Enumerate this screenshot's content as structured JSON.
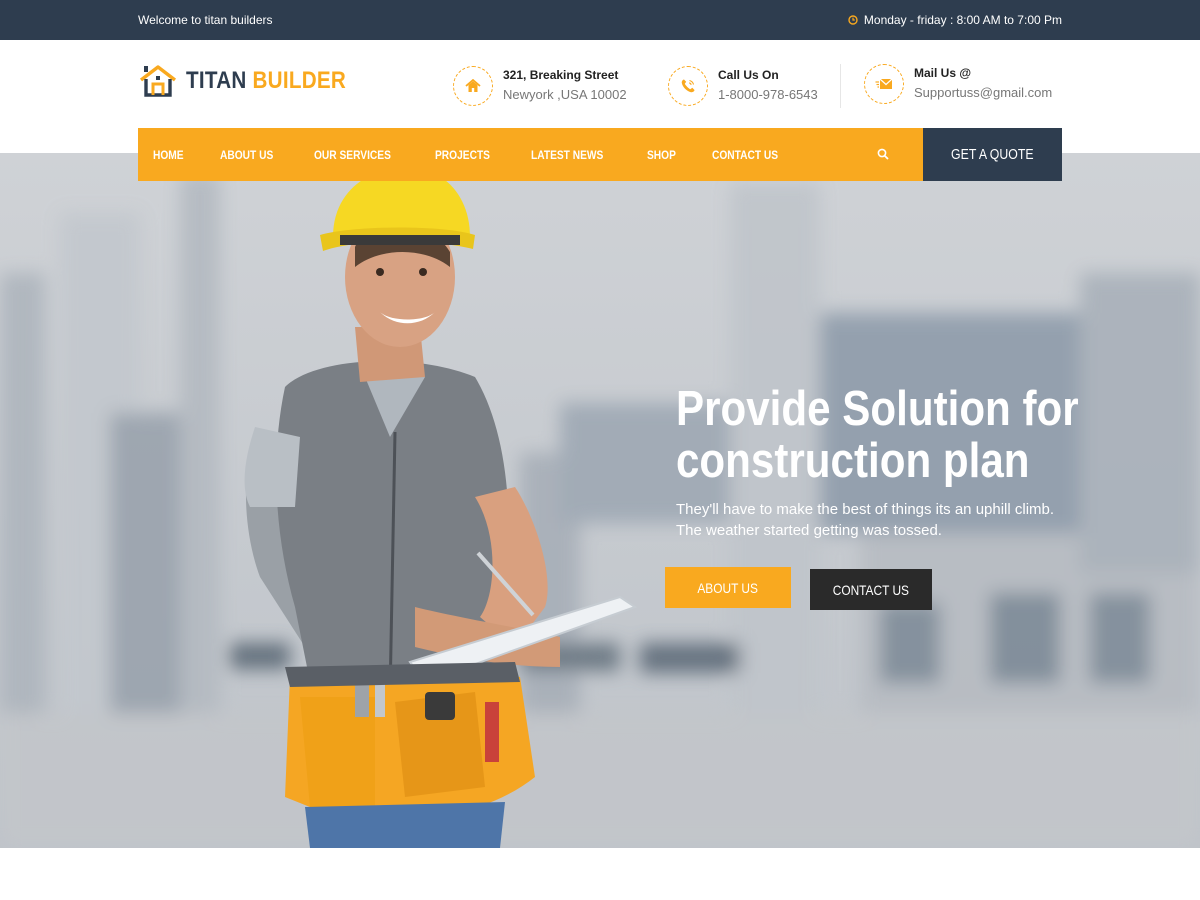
{
  "topbar": {
    "welcome": "Welcome to titan builders",
    "hours": "Monday - friday : 8:00 AM to 7:00 Pm",
    "hours_icon": "clock-icon"
  },
  "logo": {
    "word1": "TITAN",
    "word2": "BUILDER",
    "icon": "house-icon"
  },
  "contact_info": {
    "address": {
      "title": "321, Breaking Street",
      "detail": "Newyork ,USA 10002",
      "icon": "home-icon"
    },
    "phone": {
      "title": "Call Us On",
      "detail": "1-8000-978-6543",
      "icon": "phone-icon"
    },
    "mail": {
      "title": "Mail Us @",
      "detail": "Supportuss@gmail.com",
      "icon": "envelope-icon"
    }
  },
  "nav": {
    "items": [
      {
        "label": "HOME"
      },
      {
        "label": "ABOUT US"
      },
      {
        "label": "OUR SERVICES"
      },
      {
        "label": "PROJECTS"
      },
      {
        "label": "LATEST NEWS"
      },
      {
        "label": "SHOP"
      },
      {
        "label": "CONTACT US"
      }
    ],
    "search_icon": "search-icon",
    "quote_label": "GET A QUOTE"
  },
  "hero": {
    "title_line1": "Provide Solution for",
    "title_line2": "construction plan",
    "subtitle_line1": "They'll have to make the best of things its an uphill climb.",
    "subtitle_line2": "The weather started getting was tossed.",
    "about_button": "ABOUT US",
    "contact_button": "CONTACT US",
    "image": "construction-worker-with-hard-hat-and-clipboard"
  },
  "colors": {
    "accent": "#f9a91f",
    "dark": "#2e3d4f",
    "button_dark": "#2a2a2a"
  }
}
